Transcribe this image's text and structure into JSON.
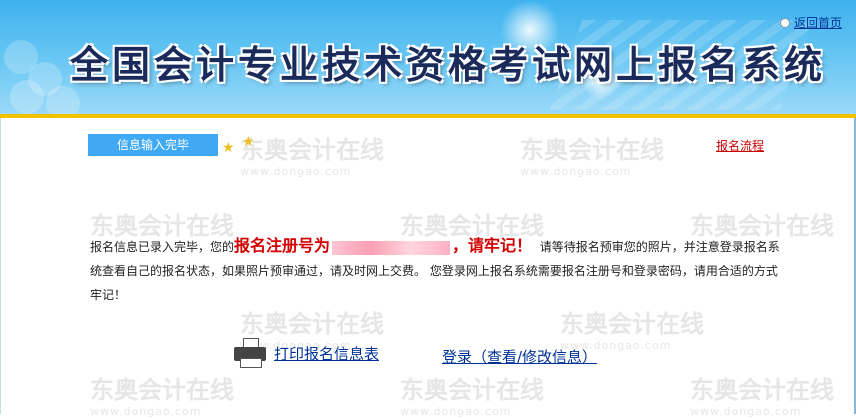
{
  "header": {
    "title": "全国会计专业技术资格考试网上报名系统",
    "home_link": "返回首页"
  },
  "status": {
    "step_label": "信息输入完毕",
    "flow_link": "报名流程"
  },
  "message": {
    "part1": "报名信息已录入完毕，您的",
    "reg_label": "报名注册号为",
    "remember": "，请牢记！",
    "part2": "请等待报名预审您的照片，并注意登录报名系统查看自己的报名状态，如果照片预审通过，请及时网上交费。 您登录网上报名系统需要报名注册号和登录密码，请用合适的方式牢记！"
  },
  "actions": {
    "print_label": "打印报名信息表",
    "login_label": "登录（查看/修改信息）"
  },
  "colors": {
    "header_blue": "#3fb2ee",
    "gold": "#f2c200",
    "tab_blue": "#3fa9f5",
    "alert_red": "#d40000",
    "link_blue": "#003399"
  }
}
